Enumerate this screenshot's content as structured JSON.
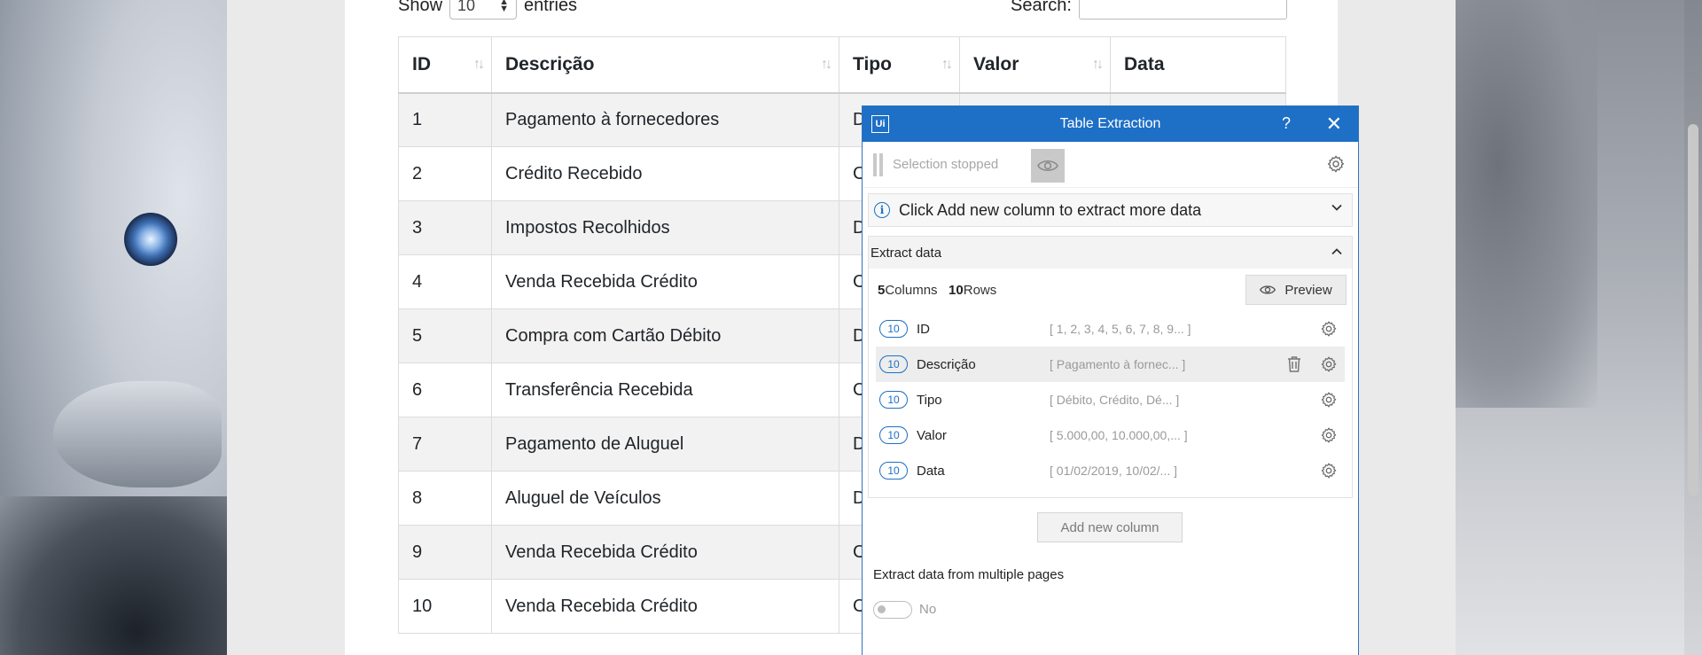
{
  "page": {
    "show_prefix": "Show",
    "length_value": "10",
    "show_suffix": "entries",
    "search_label": "Search:",
    "search_value": ""
  },
  "table": {
    "headers": [
      "ID",
      "Descrição",
      "Tipo",
      "Valor",
      "Data"
    ],
    "rows": [
      {
        "id": "1",
        "desc": "Pagamento à fornecedores",
        "tipo": "D"
      },
      {
        "id": "2",
        "desc": "Crédito Recebido",
        "tipo": "C"
      },
      {
        "id": "3",
        "desc": "Impostos Recolhidos",
        "tipo": "D"
      },
      {
        "id": "4",
        "desc": "Venda Recebida Crédito",
        "tipo": "C"
      },
      {
        "id": "5",
        "desc": "Compra com Cartão Débito",
        "tipo": "D"
      },
      {
        "id": "6",
        "desc": "Transferência Recebida",
        "tipo": "C"
      },
      {
        "id": "7",
        "desc": "Pagamento de Aluguel",
        "tipo": "D"
      },
      {
        "id": "8",
        "desc": "Aluguel de Veículos",
        "tipo": "D"
      },
      {
        "id": "9",
        "desc": "Venda Recebida Crédito",
        "tipo": "C"
      },
      {
        "id": "10",
        "desc": "Venda Recebida Crédito",
        "tipo": "C"
      }
    ]
  },
  "extraction": {
    "logo": "Ui",
    "title": "Table Extraction",
    "help": "?",
    "close": "✕",
    "selection_status": "Selection stopped",
    "info_text": "Click Add new column to extract more data",
    "section_title": "Extract data",
    "columns_count": "5",
    "columns_label": " Columns",
    "rows_count": "10",
    "rows_label": " Rows",
    "preview_label": "Preview",
    "columns": [
      {
        "count": "10",
        "name": "ID",
        "sample": "[ 1, 2, 3, 4, 5, 6, 7, 8, 9... ]"
      },
      {
        "count": "10",
        "name": "Descrição",
        "sample": "[ Pagamento à fornec... ]"
      },
      {
        "count": "10",
        "name": "Tipo",
        "sample": "[ Débito, Crédito, Dé...  ]"
      },
      {
        "count": "10",
        "name": "Valor",
        "sample": "[ 5.000,00, 10.000,00,...  ]"
      },
      {
        "count": "10",
        "name": "Data",
        "sample": "[ 01/02/2019, 10/02/...  ]"
      }
    ],
    "add_column_label": "Add new column",
    "multi_pages_label": "Extract data from multiple pages",
    "multi_pages_value": "No"
  },
  "colors": {
    "accent": "#1e6fc6",
    "row_stripe": "#f2f2f2"
  }
}
